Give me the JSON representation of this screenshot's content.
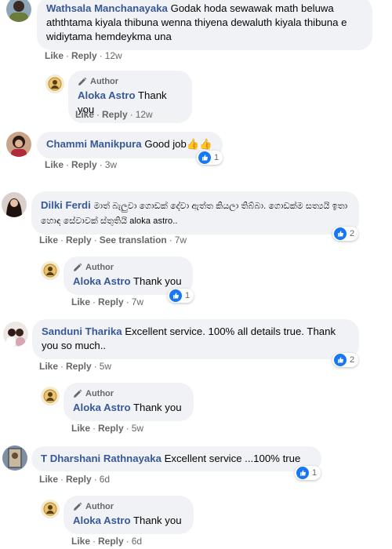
{
  "colors": {
    "name": "#385898",
    "bubble": "#f0f2f5",
    "meta": "#65676b",
    "like_blue": "#1877f2"
  },
  "comments": [
    {
      "name": "Wathsala Manchanayaka",
      "text": "Godak hoda sewawak math beluwa aththtama kiyala thibuna wenna thiyena dewaluth kiyala thibuna e widiytama hemdeykma una",
      "actions": {
        "like": "Like",
        "reply": "Reply",
        "time": "12w"
      },
      "reply": {
        "author_label": "Author",
        "name": "Aloka Astro",
        "text": "Thank you",
        "actions": {
          "like": "Like",
          "reply": "Reply",
          "time": "12w"
        }
      }
    },
    {
      "name": "Chammi Manikpura",
      "text": "Good job",
      "emoji": "👍👍",
      "reactions": "1",
      "actions": {
        "like": "Like",
        "reply": "Reply",
        "time": "3w"
      }
    },
    {
      "name": "Dilki Ferdi",
      "text": "මාත් බැලුවා ගොඩක් දේවා ඇත්ත කියලා තිබ්බා. ගොඩක්ම සත්‍යයි ඉතා හොඳ සේවාවක් ස්තුතියි aloka astro..",
      "reactions": "2",
      "actions": {
        "like": "Like",
        "reply": "Reply",
        "translate": "See translation",
        "time": "7w"
      },
      "reply": {
        "author_label": "Author",
        "name": "Aloka Astro",
        "text": "Thank you",
        "reactions": "1",
        "actions": {
          "like": "Like",
          "reply": "Reply",
          "time": "7w"
        }
      }
    },
    {
      "name": "Sanduni Tharika",
      "text": "Excellent service. 100% all details true. Thank you so much..",
      "reactions": "2",
      "actions": {
        "like": "Like",
        "reply": "Reply",
        "time": "5w"
      },
      "reply": {
        "author_label": "Author",
        "name": "Aloka Astro",
        "text": "Thank you",
        "actions": {
          "like": "Like",
          "reply": "Reply",
          "time": "5w"
        }
      }
    },
    {
      "name": "T Dharshani Rathnayaka",
      "text": "Excellent service ...100% true",
      "reactions": "1",
      "actions": {
        "like": "Like",
        "reply": "Reply",
        "time": "6d"
      },
      "reply": {
        "author_label": "Author",
        "name": "Aloka Astro",
        "text": "Thank you",
        "actions": {
          "like": "Like",
          "reply": "Reply",
          "time": "6d"
        }
      }
    }
  ]
}
